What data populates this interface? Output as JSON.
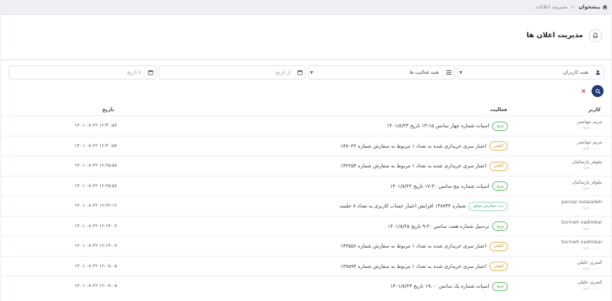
{
  "breadcrumb": {
    "home": "پیشخوان",
    "separator": "←",
    "current": "مدیریت اعلانات"
  },
  "header": {
    "title": "مدیریت اعلان ها"
  },
  "filters": {
    "user_select": "همه کاربران",
    "activity_select": "همه فعالیت ها",
    "from_date_placeholder": "از تاریخ",
    "to_date_placeholder": "تا تاریخ"
  },
  "buttons": {
    "clear": "×"
  },
  "table": {
    "columns": {
      "user": "کاربر",
      "activity": "فعالیت",
      "date": "تاریخ"
    },
    "rows": [
      {
        "user": "مریم جهانسر",
        "user_sub": "۰۹۱۲۰۰۰۰۰۰۰",
        "badge": "ورود",
        "badge_type": "in",
        "text": "اسپات شماره چهار سانس ۱۳:۱۵ تاریخ ۱۴۰۱/۸/۲۳",
        "date": "۱۴۰۱-۰۸-۲۲ ۱۶:۳۰:۵۷"
      },
      {
        "user": "مریم جهانسر",
        "user_sub": "۰۹۱۲۰۰۰۰۰۰۰",
        "badge": "کاهش",
        "badge_type": "dec",
        "text": "اعتبار سری خریداری شده به تعداد ۱ مربوط به سفارش شماره ۱۴۷۰۴۴",
        "date": "۱۴۰۱-۰۸-۲۲ ۱۶:۳۰:۵۷"
      },
      {
        "user": "نیلوفر پارسائیان",
        "user_sub": "۰۹۱۲۰۰۰۰۰۰۰",
        "badge": "کاهش",
        "badge_type": "dec",
        "text": "اعتبار سری خریداری شده به تعداد ۱ مربوط به سفارش شماره ۱۴۲۲۵۴",
        "date": "۱۴۰۱-۰۸-۲۲ ۱۶:۲۵:۵۸"
      },
      {
        "user": "نیلوفر پارسائیان",
        "user_sub": "۰۹۱۲۰۰۰۰۰۰۰",
        "badge": "ورود",
        "badge_type": "in",
        "text": "اسپات شماره پنج سانس ۱۷:۳۰ تاریخ ۱۴۰۱/۸/۲۲",
        "date": "۱۴۰۱-۰۸-۲۲ ۱۶:۲۵:۵۸"
      },
      {
        "user": "parnaz rezazadeh",
        "user_sub": "۰۹۱۲۰۰۰۰۰۰۰",
        "badge": "ثبت سفارش موفق",
        "badge_type": "ok",
        "text": "شماره ۱۴۸۷۴۴ افزایش اعتبار حساب کاربری به تعداد ۸ جلسه",
        "date": "۱۴۰۱-۰۸-۲۲ ۱۶:۲۲:۱۶"
      },
      {
        "user": "Sorrneh nadimkar",
        "user_sub": "۰۹۱۲۰۰۰۰۰۰۰",
        "badge": "ورود",
        "badge_type": "in",
        "text": "تردمیل شماره هفت سانس ۹:۳۰ تاریخ ۱۴۰۱/۸/۲۵",
        "date": "۱۴۰۱-۰۸-۲۲ ۱۶:۱۴:۰۷"
      },
      {
        "user": "Sorrneh nadimkar",
        "user_sub": "۰۹۱۲۰۰۰۰۰۰۰",
        "badge": "کاهش",
        "badge_type": "dec",
        "text": "اعتبار سری خریداری شده به تعداد ۱ مربوط به سفارش شماره ۱۴۳۵۵۶",
        "date": "۱۴۰۱-۰۸-۲۲ ۱۶:۱۴:۰۷"
      },
      {
        "user": "کسری خلیلی",
        "user_sub": "۰۹۱۲۰۰۰۰۰۰۰",
        "badge": "کاهش",
        "badge_type": "dec",
        "text": "اعتبار سری خریداری شده به تعداد ۱ مربوط به سفارش شماره ۱۴۷۵۹۴",
        "date": "۱۴۰۱-۰۸-۲۲ ۱۶:۰۸:۰۵"
      },
      {
        "user": "کسری خلیلی",
        "user_sub": "۰۹۱۲۰۰۰۰۰۰۰",
        "badge": "ورود",
        "badge_type": "in",
        "text": "اسپات شماره یک سانس ۱۹:۰۰ تاریخ ۱۴۰۱/۸/۲۳",
        "date": "۱۴۰۱-۰۸-۲۲ ۱۶:۰۸:۰۵"
      }
    ]
  },
  "colors": {
    "accent": "#1f3b73",
    "badge_in": "#5cb85c",
    "badge_decrease": "#f0ad4e",
    "badge_success": "#9ad9c0",
    "clear": "#dd3333"
  }
}
